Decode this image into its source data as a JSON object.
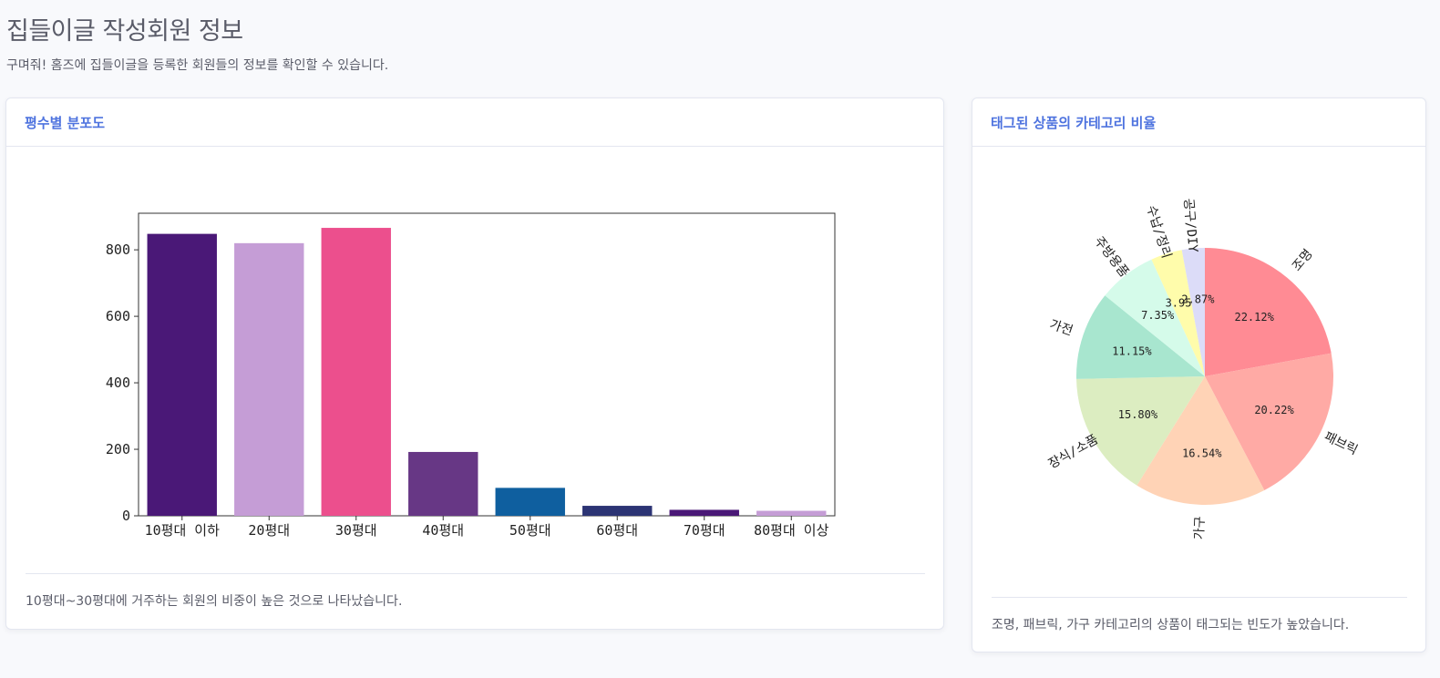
{
  "page": {
    "title": "집들이글 작성회원 정보",
    "subtitle": "구며줘! 홈즈에 집들이글을 등록한 회원들의 정보를 확인할 수 있습니다."
  },
  "bar_card": {
    "title": "평수별 분포도",
    "footer": "10평대~30평대에 거주하는 회원의 비중이 높은 것으로 나타났습니다."
  },
  "pie_card": {
    "title": "태그된 상품의 카테고리 비율",
    "footer": "조명, 패브릭, 가구 카테고리의 상품이 태그되는 빈도가 높았습니다."
  },
  "chart_data": [
    {
      "type": "bar",
      "categories": [
        "10평대 이하",
        "20평대",
        "30평대",
        "40평대",
        "50평대",
        "60평대",
        "70평대",
        "80평대 이상"
      ],
      "values": [
        848,
        820,
        866,
        192,
        84,
        30,
        18,
        15
      ],
      "colors": [
        "#4a1877",
        "#c59dd6",
        "#ec4f8d",
        "#673785",
        "#0f5f9f",
        "#2c3474",
        "#4a1877",
        "#c59dd6"
      ],
      "yticks": [
        0,
        200,
        400,
        600,
        800
      ],
      "ylim": [
        0,
        910
      ],
      "grid": false
    },
    {
      "type": "pie",
      "labels": [
        "조명",
        "패브릭",
        "가구",
        "장식/소품",
        "가전",
        "주방용품",
        "수납/정리",
        "공구/DIY"
      ],
      "values": [
        22.12,
        20.22,
        16.54,
        15.8,
        11.15,
        7.35,
        3.95,
        2.87
      ],
      "value_labels": [
        "22.12%",
        "20.22%",
        "16.54%",
        "15.80%",
        "11.15%",
        "7.35%",
        "3.95%",
        "2.87%"
      ],
      "colors": [
        "#ff8b94",
        "#ffaaa5",
        "#ffd3b6",
        "#dcedc1",
        "#a8e6cf",
        "#d5fbea",
        "#fffcab",
        "#dcdcf8"
      ]
    }
  ]
}
